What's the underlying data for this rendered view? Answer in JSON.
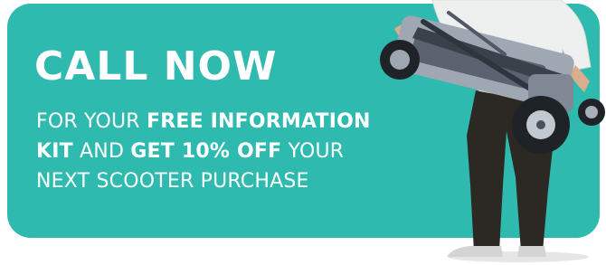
{
  "promo": {
    "headline": "CALL NOW",
    "line1_a": "FOR YOUR ",
    "line1_b": "FREE INFORMATION",
    "line2_a": "KIT",
    "line2_b": " AND ",
    "line2_c": "GET 10% OFF",
    "line2_d": " YOUR",
    "line3": "NEXT SCOOTER PURCHASE"
  },
  "colors": {
    "banner": "#2fbaaf",
    "text": "#ffffff"
  },
  "image": {
    "subject": "person-holding-folded-mobility-scooter"
  }
}
